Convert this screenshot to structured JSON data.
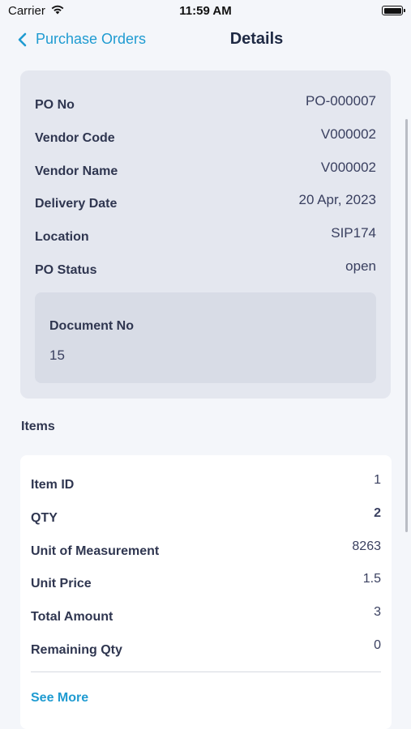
{
  "status_bar": {
    "carrier": "Carrier",
    "time": "11:59 AM",
    "wifi_icon": "wifi-icon",
    "battery_icon": "battery-icon"
  },
  "nav": {
    "back_label": "Purchase Orders",
    "title": "Details"
  },
  "po": {
    "fields": [
      {
        "label": "PO No",
        "value": "PO-000007"
      },
      {
        "label": "Vendor Code",
        "value": "V000002"
      },
      {
        "label": "Vendor Name",
        "value": "V000002"
      },
      {
        "label": "Delivery Date",
        "value": "20 Apr, 2023"
      },
      {
        "label": "Location",
        "value": "SIP174"
      },
      {
        "label": "PO Status",
        "value": "open"
      }
    ],
    "document": {
      "label": "Document No",
      "value": "15"
    }
  },
  "items": {
    "heading": "Items",
    "fields": [
      {
        "label": "Item ID",
        "value": "1"
      },
      {
        "label": "QTY",
        "value": "2"
      },
      {
        "label": "Unit of Measurement",
        "value": "8263"
      },
      {
        "label": "Unit Price",
        "value": "1.5"
      },
      {
        "label": "Total Amount",
        "value": "3"
      },
      {
        "label": "Remaining Qty",
        "value": "0"
      }
    ],
    "see_more": "See More"
  },
  "colors": {
    "accent": "#1f9bd1",
    "card_bg": "#e4e7ef",
    "text": "#2f3650"
  }
}
